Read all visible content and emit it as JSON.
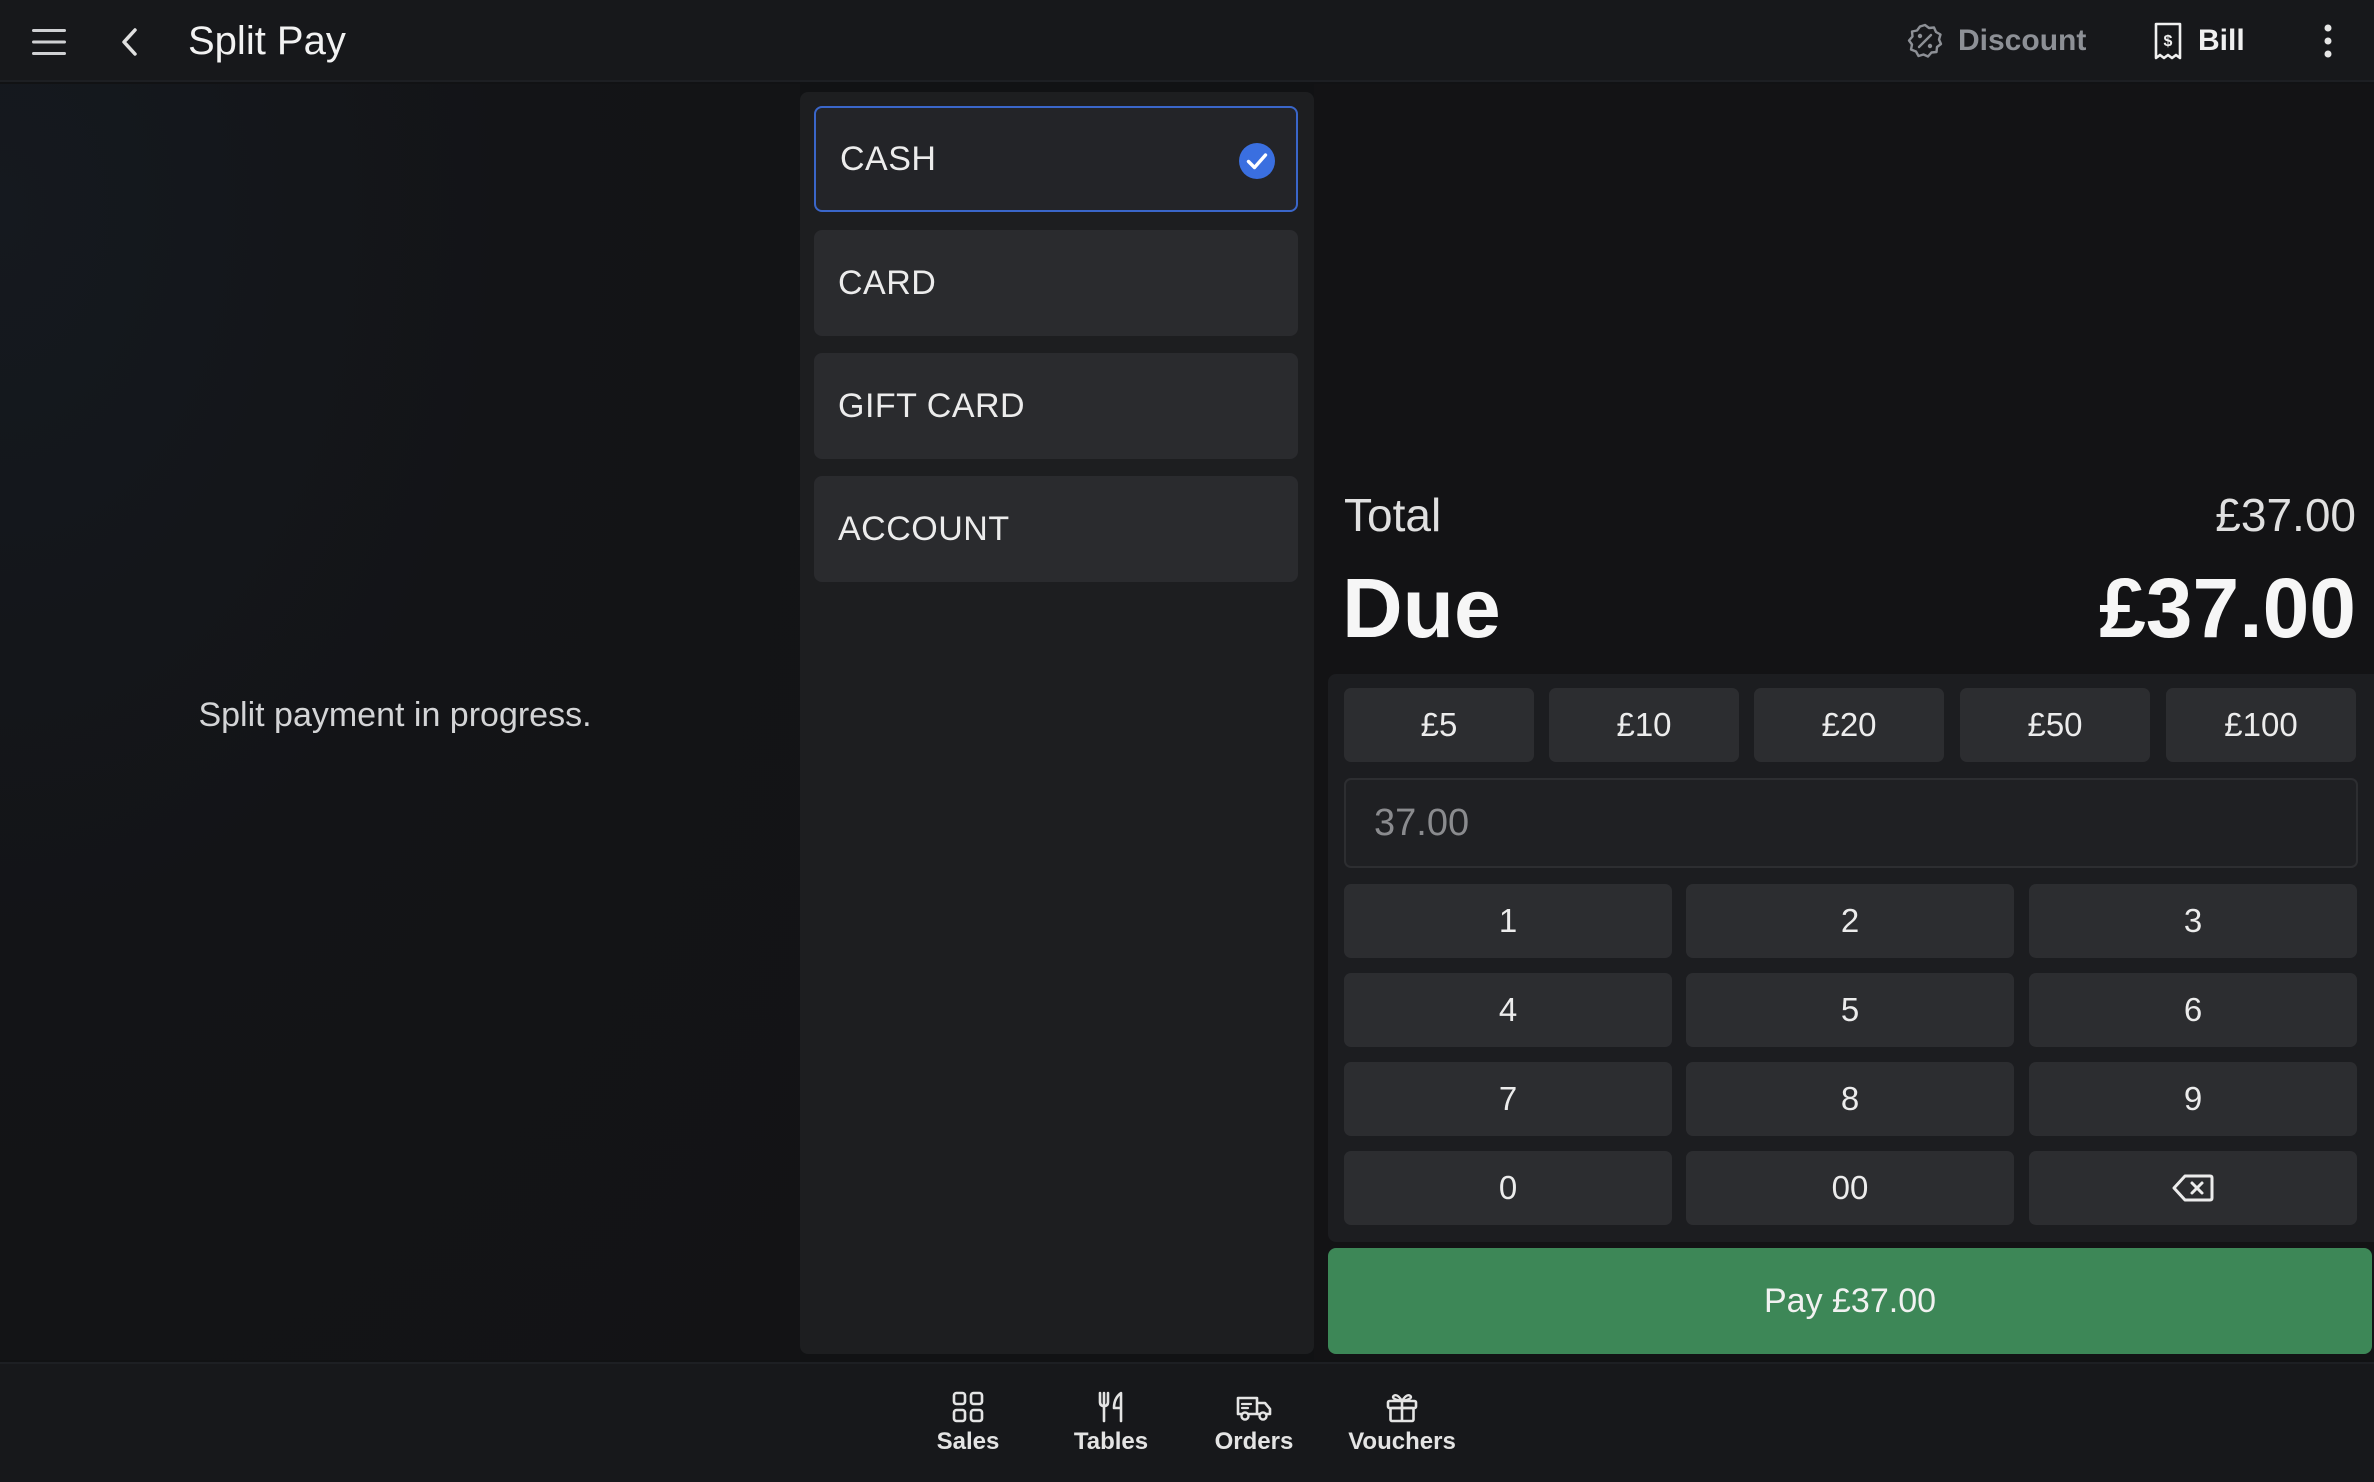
{
  "header": {
    "title": "Split Pay",
    "discount_label": "Discount",
    "bill_label": "Bill",
    "icons": [
      "menu-icon",
      "back-chevron-icon",
      "discount-badge-icon",
      "receipt-icon",
      "more-vertical-icon"
    ]
  },
  "left_panel": {
    "message": "Split payment in progress."
  },
  "payment_methods": [
    {
      "label": "CASH",
      "selected": true
    },
    {
      "label": "CARD",
      "selected": false
    },
    {
      "label": "GIFT CARD",
      "selected": false
    },
    {
      "label": "ACCOUNT",
      "selected": false
    }
  ],
  "summary": {
    "total_label": "Total",
    "total_value": "£37.00",
    "due_label": "Due",
    "due_value": "£37.00"
  },
  "quick_amounts": [
    "£5",
    "£10",
    "£20",
    "£50",
    "£100"
  ],
  "amount_input": {
    "placeholder": "37.00",
    "value": ""
  },
  "keypad": {
    "keys": [
      "1",
      "2",
      "3",
      "4",
      "5",
      "6",
      "7",
      "8",
      "9",
      "0",
      "00"
    ],
    "backspace_icon": "backspace-icon"
  },
  "pay_button": {
    "label": "Pay £37.00"
  },
  "bottom_nav": [
    {
      "label": "Sales",
      "icon": "grid-icon"
    },
    {
      "label": "Tables",
      "icon": "utensils-icon"
    },
    {
      "label": "Orders",
      "icon": "delivery-truck-icon"
    },
    {
      "label": "Vouchers",
      "icon": "gift-icon"
    }
  ],
  "colors": {
    "accent_blue": "#3a66c9",
    "pay_green": "#3d8757",
    "background": "#131315",
    "button": "#2c2d30"
  }
}
